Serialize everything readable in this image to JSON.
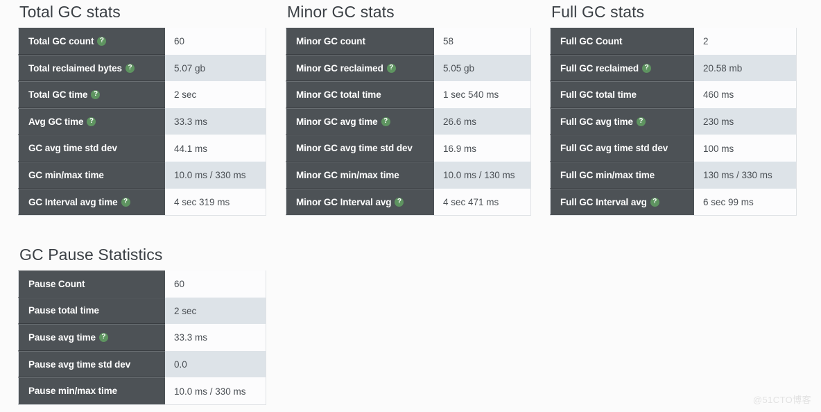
{
  "page": {
    "background": "#fbfbfb",
    "watermark": "@51CTO博客",
    "accent_help_color": "#5e9460",
    "label_cell_color": "#4d5256",
    "alt_row_color": "#dde3e8"
  },
  "panels": [
    {
      "id": "total-gc-stats",
      "title": "Total GC stats",
      "rows": [
        {
          "label": "Total GC count",
          "help": true,
          "value": "60"
        },
        {
          "label": "Total reclaimed bytes",
          "help": true,
          "value": "5.07 gb"
        },
        {
          "label": "Total GC time",
          "help": true,
          "value": "2 sec"
        },
        {
          "label": "Avg GC time",
          "help": true,
          "value": "33.3 ms"
        },
        {
          "label": "GC avg time std dev",
          "help": false,
          "value": "44.1 ms"
        },
        {
          "label": "GC min/max time",
          "help": false,
          "value": "10.0 ms / 330 ms"
        },
        {
          "label": "GC Interval avg time",
          "help": true,
          "value": "4 sec 319 ms"
        }
      ]
    },
    {
      "id": "minor-gc-stats",
      "title": "Minor GC stats",
      "rows": [
        {
          "label": "Minor GC count",
          "help": false,
          "value": "58"
        },
        {
          "label": "Minor GC reclaimed",
          "help": true,
          "value": "5.05 gb"
        },
        {
          "label": "Minor GC total time",
          "help": false,
          "value": "1 sec 540 ms"
        },
        {
          "label": "Minor GC avg time",
          "help": true,
          "value": "26.6 ms"
        },
        {
          "label": "Minor GC avg time std dev",
          "help": false,
          "value": "16.9 ms"
        },
        {
          "label": "Minor GC min/max time",
          "help": false,
          "value": "10.0 ms / 130 ms"
        },
        {
          "label": "Minor GC Interval avg",
          "help": true,
          "value": "4 sec 471 ms"
        }
      ]
    },
    {
      "id": "full-gc-stats",
      "title": "Full GC stats",
      "rows": [
        {
          "label": "Full GC Count",
          "help": false,
          "value": "2"
        },
        {
          "label": "Full GC reclaimed",
          "help": true,
          "value": "20.58 mb"
        },
        {
          "label": "Full GC total time",
          "help": false,
          "value": "460 ms"
        },
        {
          "label": "Full GC avg time",
          "help": true,
          "value": "230 ms"
        },
        {
          "label": "Full GC avg time std dev",
          "help": false,
          "value": "100 ms"
        },
        {
          "label": "Full GC min/max time",
          "help": false,
          "value": "130 ms / 330 ms"
        },
        {
          "label": "Full GC Interval avg",
          "help": true,
          "value": "6 sec 99 ms"
        }
      ]
    },
    {
      "id": "gc-pause-statistics",
      "title": "GC Pause Statistics",
      "rows": [
        {
          "label": "Pause Count",
          "help": false,
          "value": "60"
        },
        {
          "label": "Pause total time",
          "help": false,
          "value": "2 sec"
        },
        {
          "label": "Pause avg time",
          "help": true,
          "value": "33.3 ms"
        },
        {
          "label": "Pause avg time std dev",
          "help": false,
          "value": "0.0"
        },
        {
          "label": "Pause min/max time",
          "help": false,
          "value": "10.0 ms / 330 ms"
        }
      ]
    }
  ]
}
